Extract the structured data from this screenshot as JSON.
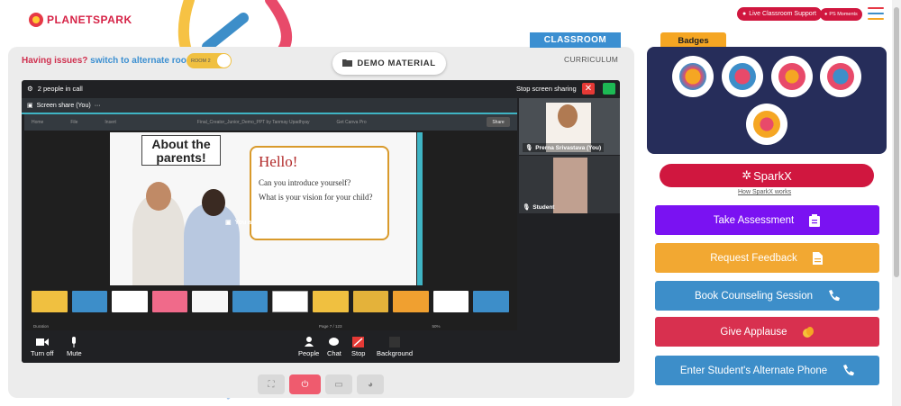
{
  "header": {
    "logo_text": "PLANETSPARK",
    "live_support": "Live Classroom Support",
    "ps_moments": "PS Moments"
  },
  "classroom": {
    "issues_text": "Having issues?",
    "alternate_link": "switch to alternate room",
    "room_toggle": "ROOM 2",
    "demo_material": "DEMO MATERIAL",
    "classroom_tab": "CLASSROOM",
    "curriculum": "CURRICULUM"
  },
  "meet": {
    "people_count": "2 people in call",
    "stop_sharing": "Stop screen sharing",
    "screen_share_tab": "Screen share (You)",
    "ribbon_items": [
      "Home",
      "File",
      "Insert"
    ],
    "ribbon_file": "Final_Creator_Junior_Demo_PPT by Tanmay Upadhyay",
    "ribbon_canva": "Get Canva Pro",
    "share_label": "Share",
    "sharing_message": "You are sharing your screen",
    "slide_about": "About the parents!",
    "slide_hello": "Hello!",
    "slide_line1": "Can you introduce yourself?",
    "slide_line2": "What is your vision for your child?",
    "status_duration": "Duration",
    "status_page": "Page 7 / 123",
    "status_zoom": "50%",
    "participants": [
      {
        "name": "Prerna Srivastava (You)"
      },
      {
        "name": "Student"
      }
    ],
    "toolbar": {
      "turn_off": "Turn off",
      "mute": "Mute",
      "people": "People",
      "chat": "Chat",
      "stop": "Stop",
      "background": "Background"
    }
  },
  "right": {
    "badges_title": "Badges",
    "sparkx": "SparkX",
    "how_sparkx": "How SparkX works",
    "actions": [
      {
        "label": "Take Assessment",
        "color": "#7a12f2"
      },
      {
        "label": "Request Feedback",
        "color": "#f2a832"
      },
      {
        "label": "Book Counseling Session",
        "color": "#3d8ec9"
      },
      {
        "label": "Give Applause",
        "color": "#d8304f"
      },
      {
        "label": "Enter Student's Alternate Phone",
        "color": "#3d8ec9"
      }
    ]
  }
}
